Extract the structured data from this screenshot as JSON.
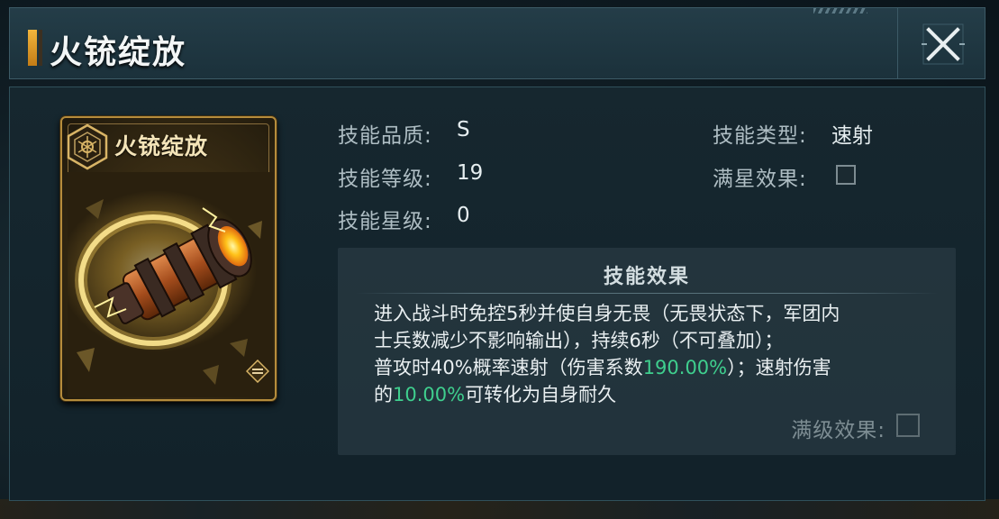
{
  "window": {
    "title": "火铳绽放"
  },
  "card": {
    "title": "火铳绽放"
  },
  "stats": {
    "quality_label": "技能品质:",
    "quality_value": "S",
    "level_label": "技能等级:",
    "level_value": "19",
    "star_label": "技能星级:",
    "star_value": "0",
    "type_label": "技能类型:",
    "type_value": "速射",
    "fullstar_label": "满星效果:"
  },
  "effect": {
    "title": "技能效果",
    "line1": "进入战斗时免控5秒并使自身无畏（无畏状态下，军团内",
    "line2": "士兵数减少不影响输出），持续6秒（不可叠加）；",
    "line3_a": "普攻时40%概率速射（伤害系数",
    "line3_b": "190.00%",
    "line3_c": "）；速射伤害",
    "line4_a": "的",
    "line4_b": "10.00%",
    "line4_c": "可转化为自身耐久",
    "max_level_label": "满级效果:"
  },
  "colors": {
    "highlight": "#3fcf8e",
    "accent": "#f2b53c"
  },
  "icons": [
    "close-icon",
    "hexagon-emblem-icon",
    "cannon-art",
    "card-corner-icon"
  ]
}
